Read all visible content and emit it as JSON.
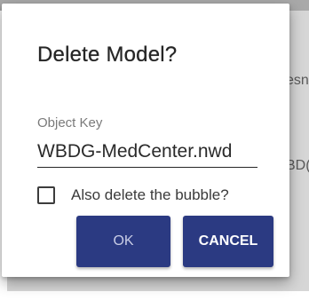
{
  "background": {
    "partial_text_1": "esn",
    "partial_text_2": "BD("
  },
  "dialog": {
    "title": "Delete Model?",
    "object_key": {
      "label": "Object Key",
      "value": "WBDG-MedCenter.nwd"
    },
    "checkbox": {
      "label": "Also delete the bubble?",
      "checked": false
    },
    "buttons": {
      "ok_label": "OK",
      "cancel_label": "CANCEL"
    }
  },
  "colors": {
    "button_bg": "#2b3a82",
    "title_text": "#262626"
  }
}
